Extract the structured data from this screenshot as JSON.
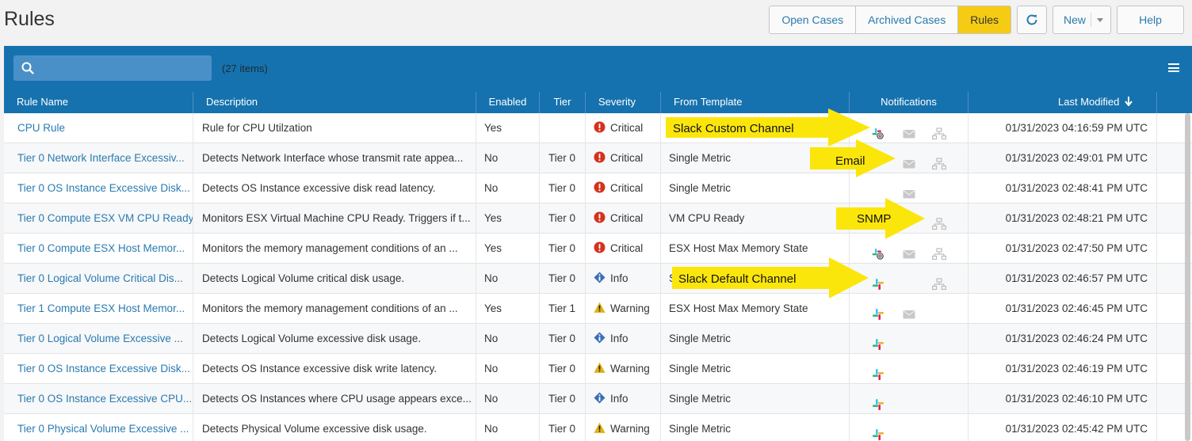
{
  "page": {
    "title": "Rules"
  },
  "nav": {
    "tabs": [
      "Open Cases",
      "Archived Cases",
      "Rules"
    ],
    "active_tab": "Rules",
    "new_label": "New",
    "help_label": "Help",
    "refresh_icon": "refresh-icon"
  },
  "toolbar": {
    "search_placeholder": "",
    "items_count": "(27 items)",
    "menu_icon": "hamburger-menu-icon"
  },
  "table": {
    "columns": {
      "name": "Rule Name",
      "description": "Description",
      "enabled": "Enabled",
      "tier": "Tier",
      "severity": "Severity",
      "template": "From Template",
      "notifications": "Notifications",
      "modified": "Last Modified"
    },
    "sort_icon": "arrow-down-icon",
    "rows": [
      {
        "name": "CPU Rule",
        "description": "Rule for CPU Utilzation",
        "enabled": "Yes",
        "tier": "",
        "severity": "Critical",
        "template": "",
        "modified": "01/31/2023 04:16:59 PM UTC"
      },
      {
        "name": "Tier 0 Network Interface Excessiv...",
        "description": "Detects Network Interface whose transmit rate appea...",
        "enabled": "No",
        "tier": "Tier 0",
        "severity": "Critical",
        "template": "Single Metric",
        "modified": "01/31/2023 02:49:01 PM UTC"
      },
      {
        "name": "Tier 0 OS Instance Excessive Disk...",
        "description": "Detects OS Instance excessive disk read latency.",
        "enabled": "No",
        "tier": "Tier 0",
        "severity": "Critical",
        "template": "Single Metric",
        "modified": "01/31/2023 02:48:41 PM UTC"
      },
      {
        "name": "Tier 0 Compute ESX VM CPU Ready",
        "description": "Monitors ESX Virtual Machine CPU Ready. Triggers if t...",
        "enabled": "Yes",
        "tier": "Tier 0",
        "severity": "Critical",
        "template": "VM CPU Ready",
        "modified": "01/31/2023 02:48:21 PM UTC"
      },
      {
        "name": "Tier 0 Compute ESX Host Memor...",
        "description": "Monitors the memory management conditions of an ...",
        "enabled": "Yes",
        "tier": "Tier 0",
        "severity": "Critical",
        "template": "ESX Host Max Memory State",
        "modified": "01/31/2023 02:47:50 PM UTC"
      },
      {
        "name": "Tier 0 Logical Volume Critical Dis...",
        "description": "Detects Logical Volume critical disk usage.",
        "enabled": "No",
        "tier": "Tier 0",
        "severity": "Info",
        "template": "S",
        "modified": "01/31/2023 02:46:57 PM UTC"
      },
      {
        "name": "Tier 1 Compute ESX Host Memor...",
        "description": "Monitors the memory management conditions of an ...",
        "enabled": "Yes",
        "tier": "Tier 1",
        "severity": "Warning",
        "template": "ESX Host Max Memory State",
        "modified": "01/31/2023 02:46:45 PM UTC"
      },
      {
        "name": "Tier 0 Logical Volume Excessive ...",
        "description": "Detects Logical Volume excessive disk usage.",
        "enabled": "No",
        "tier": "Tier 0",
        "severity": "Info",
        "template": "Single Metric",
        "modified": "01/31/2023 02:46:24 PM UTC"
      },
      {
        "name": "Tier 0 OS Instance Excessive Disk...",
        "description": "Detects OS Instance excessive disk write latency.",
        "enabled": "No",
        "tier": "Tier 0",
        "severity": "Warning",
        "template": "Single Metric",
        "modified": "01/31/2023 02:46:19 PM UTC"
      },
      {
        "name": "Tier 0 OS Instance Excessive CPU...",
        "description": "Detects OS Instances where CPU usage appears exce...",
        "enabled": "No",
        "tier": "Tier 0",
        "severity": "Info",
        "template": "Single Metric",
        "modified": "01/31/2023 02:46:10 PM UTC"
      },
      {
        "name": "Tier 0 Physical Volume Excessive ...",
        "description": "Detects Physical Volume excessive disk usage.",
        "enabled": "No",
        "tier": "Tier 0",
        "severity": "Warning",
        "template": "Single Metric",
        "modified": "01/31/2023 02:45:42 PM UTC"
      }
    ],
    "notifications": [
      [
        "slack-custom-icon",
        "email-icon",
        "snmp-icon"
      ],
      [
        "email-icon",
        "snmp-icon"
      ],
      [
        "email-icon"
      ],
      [
        "snmp-icon"
      ],
      [
        "slack-custom-icon",
        "email-icon",
        "snmp-icon"
      ],
      [
        "slack-icon",
        "snmp-icon"
      ],
      [
        "slack-icon",
        "email-icon"
      ],
      [
        "slack-icon"
      ],
      [
        "slack-icon"
      ],
      [
        "slack-icon"
      ],
      [
        "slack-icon"
      ]
    ]
  },
  "callouts": {
    "slack_custom": "Slack Custom Channel",
    "email": "Email",
    "snmp": "SNMP",
    "slack_default": "Slack Default Channel"
  },
  "colors": {
    "header_blue": "#1672ae",
    "link_blue": "#2a7ab0",
    "active_tab": "#f5cc13",
    "callout_yellow": "#fbe60c",
    "critical": "#d6311c",
    "info": "#3b6fb6",
    "warning": "#e0b112"
  }
}
